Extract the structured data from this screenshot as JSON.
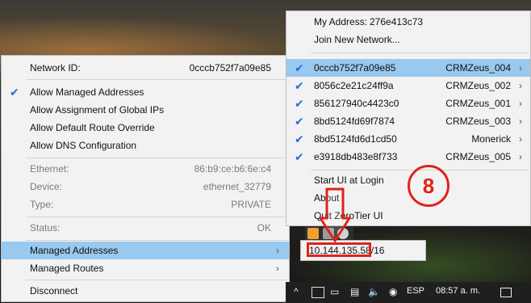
{
  "left_menu": {
    "network_id_label": "Network ID:",
    "network_id_value": "0cccb752f7a09e85",
    "options": [
      {
        "label": "Allow Managed Addresses",
        "checked": true
      },
      {
        "label": "Allow Assignment of Global IPs",
        "checked": false
      },
      {
        "label": "Allow Default Route Override",
        "checked": false
      },
      {
        "label": "Allow DNS Configuration",
        "checked": false
      }
    ],
    "info": [
      {
        "label": "Ethernet:",
        "value": "86:b9:ce:b6:6e:c4"
      },
      {
        "label": "Device:",
        "value": "ethernet_32779"
      },
      {
        "label": "Type:",
        "value": "PRIVATE"
      },
      {
        "label": "Status:",
        "value": "OK"
      }
    ],
    "managed_addresses": "Managed Addresses",
    "managed_routes": "Managed Routes",
    "disconnect": "Disconnect",
    "highlight_color": "#99c9ef"
  },
  "right_menu": {
    "my_address_label": "My Address:",
    "my_address_value": "276e413c73",
    "join_network": "Join New Network...",
    "networks": [
      {
        "id": "0cccb752f7a09e85",
        "name": "CRMZeus_004",
        "checked": true
      },
      {
        "id": "8056c2e21c24ff9a",
        "name": "CRMZeus_002",
        "checked": true
      },
      {
        "id": "856127940c4423c0",
        "name": "CRMZeus_001",
        "checked": true
      },
      {
        "id": "8bd5124fd69f7874",
        "name": "CRMZeus_003",
        "checked": true
      },
      {
        "id": "8bd5124fd6d1cd50",
        "name": "Monerick",
        "checked": true
      },
      {
        "id": "e3918db483e8f733",
        "name": "CRMZeus_005",
        "checked": true
      }
    ],
    "start_ui": "Start UI at Login",
    "about": "About",
    "quit": "Quit ZeroTier UI"
  },
  "submenu": {
    "address": "10.144.135.58",
    "suffix": "16"
  },
  "annotation": {
    "step": "8",
    "color": "#e0221b"
  },
  "taskbar": {
    "language": "ESP",
    "time": "08:57 a. m."
  }
}
